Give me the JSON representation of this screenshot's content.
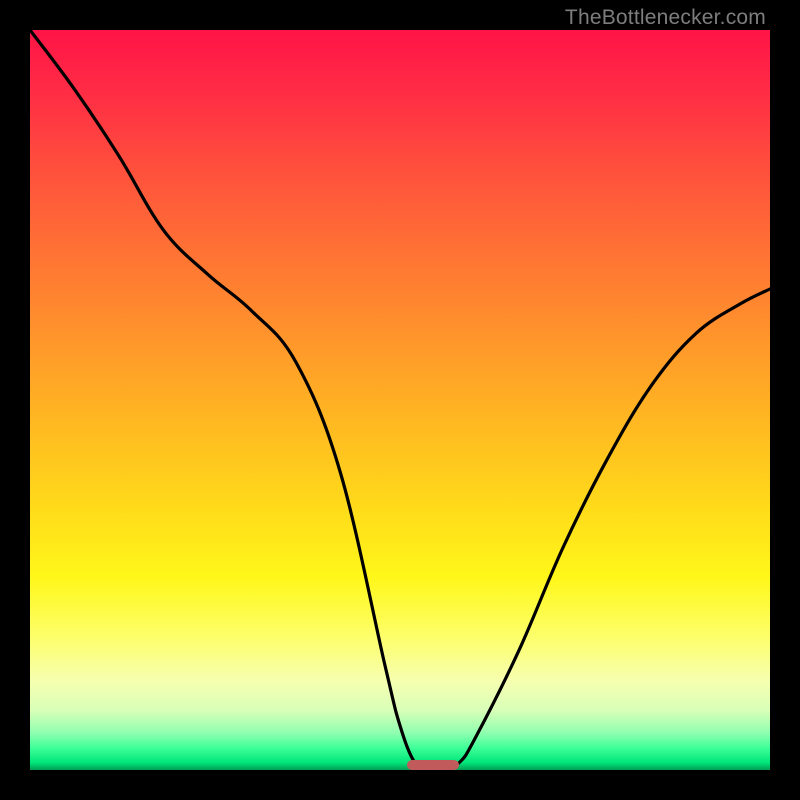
{
  "watermark": "TheBottlenecker.com",
  "colors": {
    "background": "#000000",
    "curve": "#000000",
    "optimum_bar": "#c15a5a"
  },
  "chart_data": {
    "type": "line",
    "title": "",
    "xlabel": "",
    "ylabel": "",
    "xlim": [
      0,
      100
    ],
    "ylim": [
      0,
      100
    ],
    "series": [
      {
        "name": "bottleneck-curve",
        "x": [
          0,
          6,
          12,
          18,
          24,
          30,
          36,
          42,
          48,
          50,
          52,
          54,
          56,
          58,
          60,
          66,
          72,
          78,
          84,
          90,
          96,
          100
        ],
        "values": [
          100,
          92,
          83,
          73,
          67,
          62,
          55,
          40,
          14,
          6,
          1,
          0,
          0,
          1,
          4,
          16,
          30,
          42,
          52,
          59,
          63,
          65
        ]
      }
    ],
    "optimum_range_x": [
      51,
      58
    ],
    "annotations": []
  }
}
